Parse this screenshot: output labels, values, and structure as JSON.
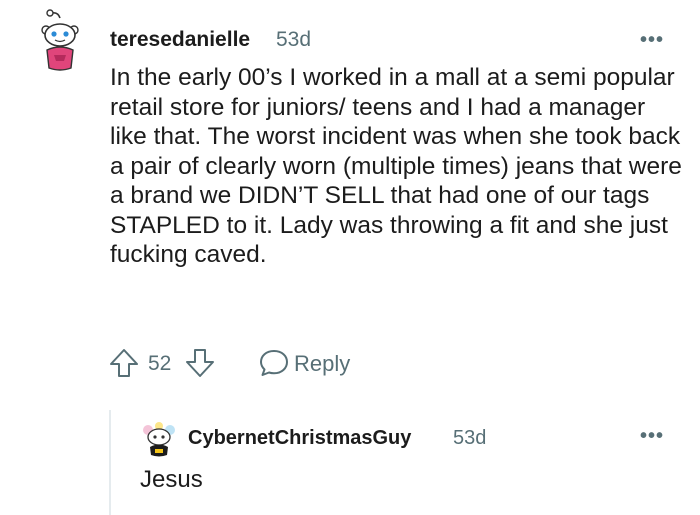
{
  "comment": {
    "username": "teresedanielle",
    "age": "53d",
    "body": "In the early 00’s I worked in a mall at a semi popular retail store for juniors/ teens and I had a manager like that. The worst incident was when she took back a pair of clearly worn (multiple times) jeans that were a brand we DIDN’T SELL that had one of our tags STAPLED to it. Lady was throwing a fit and she just fucking caved.",
    "vote_count": "52",
    "reply_label": "Reply",
    "more_label": "•••"
  },
  "reply": {
    "username": "CybernetChristmasGuy",
    "age": "53d",
    "body": "Jesus",
    "more_label": "•••"
  },
  "icons": {
    "upvote": "arrow-up-icon",
    "downvote": "arrow-down-icon",
    "reply": "speech-bubble-icon",
    "more": "ellipsis-icon"
  },
  "colors": {
    "text": "#1c1c1c",
    "meta": "#576f76",
    "thread_line": "#e5ebee",
    "avatar_shirt": "#e0457b"
  }
}
